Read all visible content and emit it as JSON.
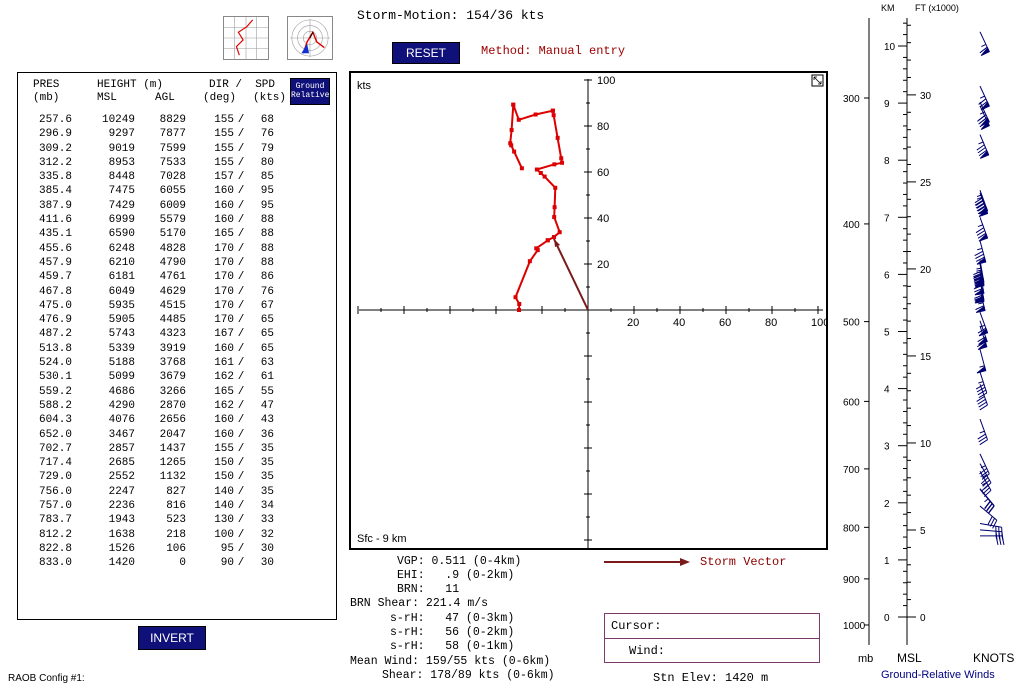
{
  "header": {
    "storm_motion": "Storm-Motion: 154/36 kts",
    "reset_label": "RESET",
    "method": "Method:  Manual entry"
  },
  "table": {
    "headers": {
      "pres": "PRES",
      "pres_unit": "(mb)",
      "height": "HEIGHT (m)",
      "msl": "MSL",
      "agl": "AGL",
      "dir_spd": "DIR /  SPD",
      "dir_unit": "(deg)",
      "spd_unit": "(kts)"
    },
    "ground_relative_label": "Ground Relative",
    "rows": [
      {
        "pres": "257.6",
        "msl": "10249",
        "agl": "8829",
        "dir": "155",
        "spd": "68"
      },
      {
        "pres": "296.9",
        "msl": "9297",
        "agl": "7877",
        "dir": "155",
        "spd": "76"
      },
      {
        "pres": "309.2",
        "msl": "9019",
        "agl": "7599",
        "dir": "155",
        "spd": "79"
      },
      {
        "pres": "312.2",
        "msl": "8953",
        "agl": "7533",
        "dir": "155",
        "spd": "80"
      },
      {
        "pres": "335.8",
        "msl": "8448",
        "agl": "7028",
        "dir": "157",
        "spd": "85"
      },
      {
        "pres": "385.4",
        "msl": "7475",
        "agl": "6055",
        "dir": "160",
        "spd": "95"
      },
      {
        "pres": "387.9",
        "msl": "7429",
        "agl": "6009",
        "dir": "160",
        "spd": "95"
      },
      {
        "pres": "411.6",
        "msl": "6999",
        "agl": "5579",
        "dir": "160",
        "spd": "88"
      },
      {
        "pres": "435.1",
        "msl": "6590",
        "agl": "5170",
        "dir": "165",
        "spd": "88"
      },
      {
        "pres": "455.6",
        "msl": "6248",
        "agl": "4828",
        "dir": "170",
        "spd": "88"
      },
      {
        "pres": "457.9",
        "msl": "6210",
        "agl": "4790",
        "dir": "170",
        "spd": "88"
      },
      {
        "pres": "459.7",
        "msl": "6181",
        "agl": "4761",
        "dir": "170",
        "spd": "86"
      },
      {
        "pres": "467.8",
        "msl": "6049",
        "agl": "4629",
        "dir": "170",
        "spd": "76"
      },
      {
        "pres": "475.0",
        "msl": "5935",
        "agl": "4515",
        "dir": "170",
        "spd": "67"
      },
      {
        "pres": "476.9",
        "msl": "5905",
        "agl": "4485",
        "dir": "170",
        "spd": "65"
      },
      {
        "pres": "487.2",
        "msl": "5743",
        "agl": "4323",
        "dir": "167",
        "spd": "65"
      },
      {
        "pres": "513.8",
        "msl": "5339",
        "agl": "3919",
        "dir": "160",
        "spd": "65"
      },
      {
        "pres": "524.0",
        "msl": "5188",
        "agl": "3768",
        "dir": "161",
        "spd": "63"
      },
      {
        "pres": "530.1",
        "msl": "5099",
        "agl": "3679",
        "dir": "162",
        "spd": "61"
      },
      {
        "pres": "559.2",
        "msl": "4686",
        "agl": "3266",
        "dir": "165",
        "spd": "55"
      },
      {
        "pres": "588.2",
        "msl": "4290",
        "agl": "2870",
        "dir": "162",
        "spd": "47"
      },
      {
        "pres": "604.3",
        "msl": "4076",
        "agl": "2656",
        "dir": "160",
        "spd": "43"
      },
      {
        "pres": "652.0",
        "msl": "3467",
        "agl": "2047",
        "dir": "160",
        "spd": "36"
      },
      {
        "pres": "702.7",
        "msl": "2857",
        "agl": "1437",
        "dir": "155",
        "spd": "35"
      },
      {
        "pres": "717.4",
        "msl": "2685",
        "agl": "1265",
        "dir": "150",
        "spd": "35"
      },
      {
        "pres": "729.0",
        "msl": "2552",
        "agl": "1132",
        "dir": "150",
        "spd": "35"
      },
      {
        "pres": "756.0",
        "msl": "2247",
        "agl": "827",
        "dir": "140",
        "spd": "35"
      },
      {
        "pres": "757.0",
        "msl": "2236",
        "agl": "816",
        "dir": "140",
        "spd": "34"
      },
      {
        "pres": "783.7",
        "msl": "1943",
        "agl": "523",
        "dir": "130",
        "spd": "33"
      },
      {
        "pres": "812.2",
        "msl": "1638",
        "agl": "218",
        "dir": "100",
        "spd": "32"
      },
      {
        "pres": "822.8",
        "msl": "1526",
        "agl": "106",
        "dir": "95",
        "spd": "30"
      },
      {
        "pres": "833.0",
        "msl": "1420",
        "agl": "0",
        "dir": "90",
        "spd": "30"
      }
    ],
    "invert_label": "INVERT"
  },
  "footer": {
    "raob_config": "RAOB Config #1:",
    "stn_elev": "Stn Elev: 1420 m"
  },
  "hodograph": {
    "units_label": "kts",
    "range_label": "Sfc - 9 km",
    "v_ticks": [
      "100",
      "80",
      "60",
      "40",
      "20"
    ],
    "h_ticks": [
      "20",
      "40",
      "60",
      "80",
      "100"
    ],
    "storm_vector_label": "Storm Vector",
    "colors": {
      "trace": "#dd0000",
      "storm_vector": "#7a1a1a"
    }
  },
  "params": {
    "vgp": "VGP: 0.511 (0-4km)",
    "ehi": "EHI:   .9 (0-2km)",
    "brn": "BRN:   11",
    "brn_shear": "BRN Shear: 221.4 m/s",
    "srh1": "s-rH:   47 (0-3km)",
    "srh2": "s-rH:   56 (0-2km)",
    "srh3": "s-rH:   58 (0-1km)",
    "mean_wind": "Mean Wind: 159/55 kts (0-6km)",
    "shear": "Shear: 178/89 kts (0-6km)"
  },
  "cursor": {
    "cursor_label": "Cursor:",
    "wind_label": "Wind:"
  },
  "right_panel": {
    "km_label": "KM",
    "ft_label": "FT (x1000)",
    "km_ticks": [
      "10",
      "9",
      "8",
      "7",
      "6",
      "5",
      "4",
      "3",
      "2",
      "1",
      "0"
    ],
    "ft_ticks": [
      "30",
      "25",
      "20",
      "15",
      "10",
      "5",
      "0"
    ],
    "pres_ticks": [
      "300",
      "400",
      "500",
      "600",
      "700",
      "800",
      "900",
      "1000"
    ],
    "mb_label": "mb",
    "msl_label": "MSL",
    "knots_label": "KNOTS",
    "caption": "Ground-Relative Winds",
    "colors": {
      "barbs": "#000070",
      "caption": "#000080"
    }
  }
}
